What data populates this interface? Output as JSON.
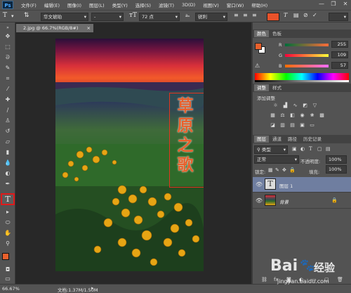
{
  "app": {
    "logo": "Ps"
  },
  "menu": [
    "文件(F)",
    "编辑(E)",
    "图像(I)",
    "图层(L)",
    "类型(Y)",
    "选择(S)",
    "滤镜(T)",
    "3D(D)",
    "视图(V)",
    "窗口(W)",
    "帮助(H)"
  ],
  "window_controls": {
    "minimize": "—",
    "restore": "❐",
    "close": "✕"
  },
  "options": {
    "font_family": "华文琥珀",
    "font_style": "-",
    "font_size": "72 点",
    "antialias": "锐利",
    "text_color": "#e8522a"
  },
  "document": {
    "tab_title": "2.jpg @ 66.7%(RGB/8#)",
    "vertical_text": "草原之歌"
  },
  "status": {
    "zoom": "66.67%",
    "doc_info": "文档:1.37M/1.50M"
  },
  "color_panel": {
    "tabs": [
      "颜色",
      "色板"
    ],
    "foreground": "#e8602c",
    "background": "#ffffff",
    "R": {
      "label": "R",
      "value": "255"
    },
    "G": {
      "label": "G",
      "value": "109"
    },
    "B": {
      "label": "B",
      "value": "57"
    }
  },
  "adjust_panel": {
    "tabs": [
      "调整",
      "样式"
    ],
    "title": "添加调整"
  },
  "layers_panel": {
    "tabs": [
      "图层",
      "通道",
      "路径",
      "历史记录"
    ],
    "filter_kind": "类型",
    "blend_mode": "正常",
    "opacity_label": "不透明度:",
    "opacity_value": "100%",
    "lock_label": "锁定:",
    "fill_label": "填充:",
    "fill_value": "100%",
    "layers": [
      {
        "name": "图层 1"
      },
      {
        "name": "背景"
      }
    ]
  },
  "watermark": {
    "brand": "Bai",
    "brand2": "经验",
    "url": "jingyan.baidu.com"
  }
}
